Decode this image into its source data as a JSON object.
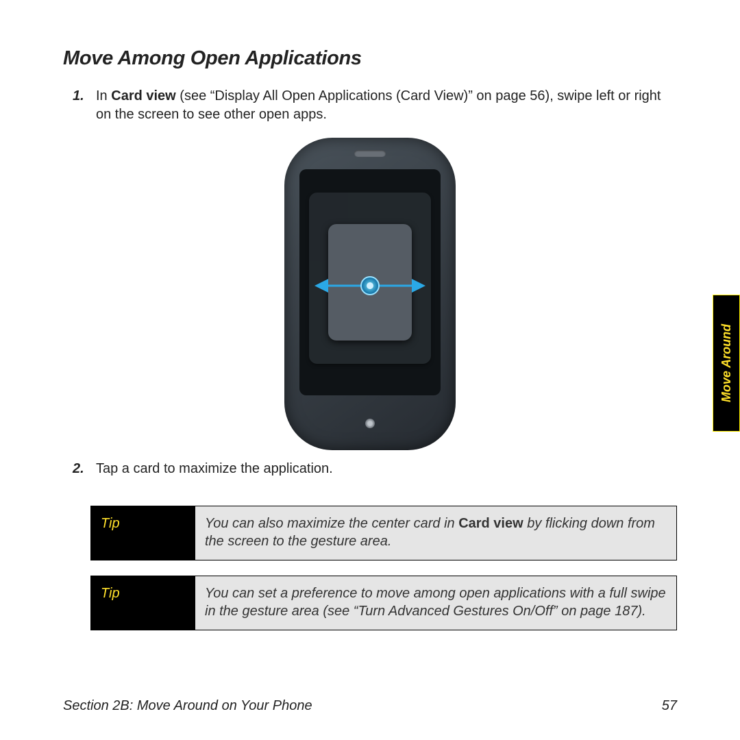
{
  "heading": "Move Among Open Applications",
  "steps": [
    {
      "num": "1.",
      "prefix": "In ",
      "bold": "Card view",
      "rest": " (see “Display All Open Applications (Card View)” on page 56), swipe left or right on the screen to see other open apps."
    },
    {
      "num": "2.",
      "prefix": "",
      "bold": "",
      "rest": "Tap a card to maximize the application."
    }
  ],
  "tips": [
    {
      "label": "Tip",
      "pre": "You can also maximize the center card in ",
      "bold": "Card view",
      "post": " by flicking down from the screen to the gesture area."
    },
    {
      "label": "Tip",
      "pre": "You can set a preference to move among open applications with a full swipe in the gesture area (see “Turn Advanced Gestures On/Off” on page 187).",
      "bold": "",
      "post": ""
    }
  ],
  "side_tab": "Move Around",
  "footer": {
    "section": "Section 2B: Move Around on Your Phone",
    "page": "57"
  }
}
